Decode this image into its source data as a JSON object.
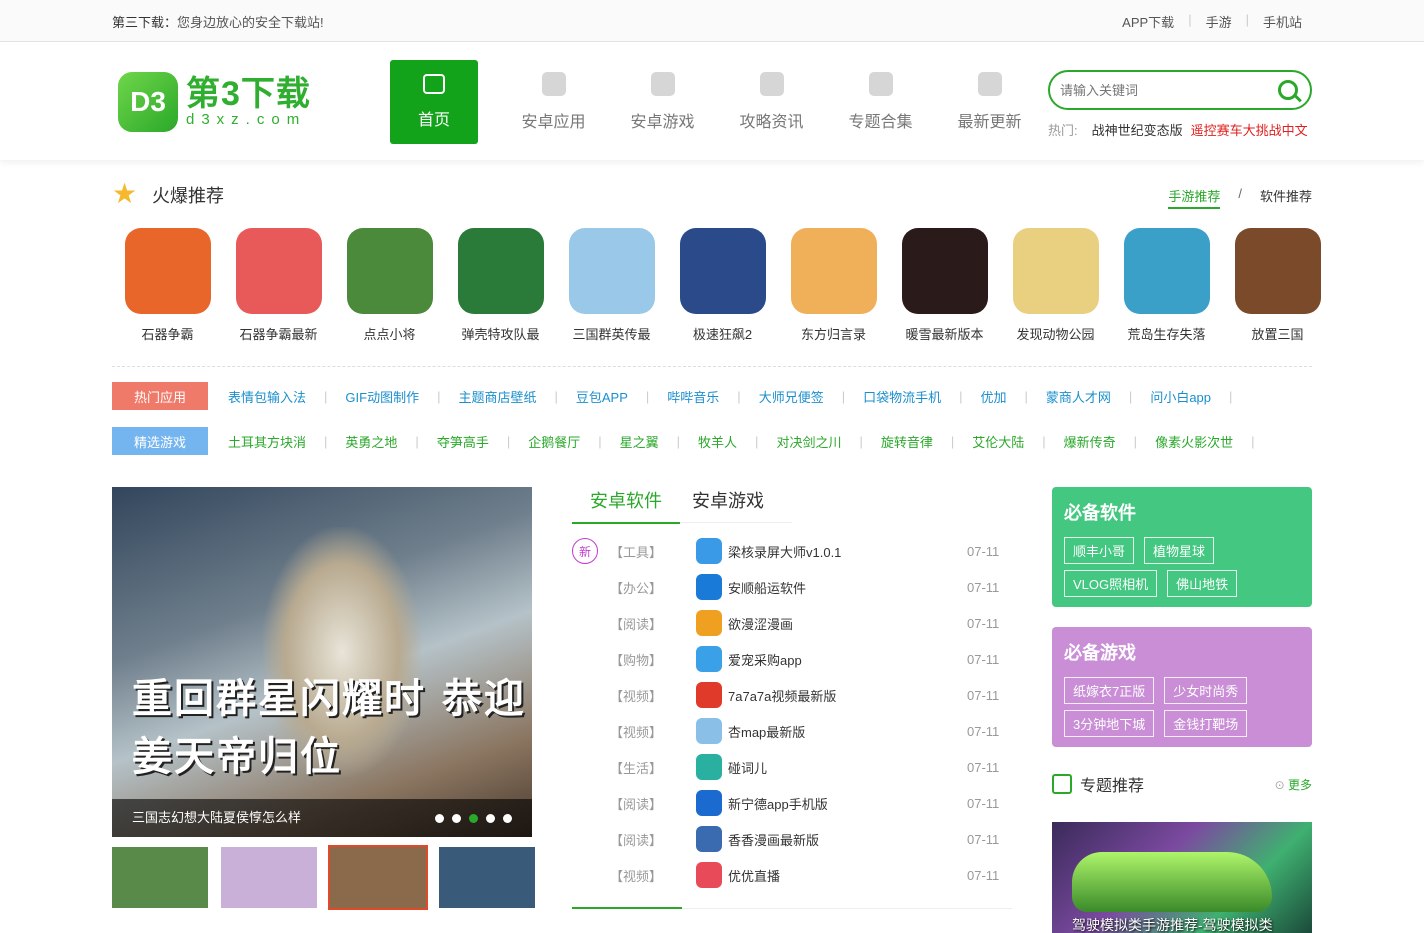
{
  "topbar": {
    "slogan_site": "第三下载：",
    "slogan_text": "您身边放心的安全下载站!",
    "links": [
      "APP下载",
      "手游",
      "手机站"
    ]
  },
  "logo": {
    "badge": "D3",
    "cn": "第3下载",
    "en": "d3xz.com"
  },
  "nav": [
    "首页",
    "安卓应用",
    "安卓游戏",
    "攻略资讯",
    "专题合集",
    "最新更新"
  ],
  "search": {
    "placeholder": "请输入关键词"
  },
  "hot": {
    "label": "热门:",
    "keywords": [
      "战神世纪变态版",
      "遥控赛车大挑战中文"
    ]
  },
  "section": {
    "title": "火爆推荐",
    "tab_active": "手游推荐",
    "tab_sep": "/",
    "tab_other": "软件推荐"
  },
  "apps": [
    {
      "name": "石器争霸",
      "color": "#e8662a"
    },
    {
      "name": "石器争霸最新",
      "color": "#e85a5a"
    },
    {
      "name": "点点小将",
      "color": "#4a8a3a"
    },
    {
      "name": "弹壳特攻队最",
      "color": "#2a7a3a"
    },
    {
      "name": "三国群英传最",
      "color": "#9ac8e8"
    },
    {
      "name": "极速狂飙2",
      "color": "#2a4a8a"
    },
    {
      "name": "东方归言录",
      "color": "#f0b05a"
    },
    {
      "name": "暖雪最新版本",
      "color": "#2a1a1a"
    },
    {
      "name": "发现动物公园",
      "color": "#e8d080"
    },
    {
      "name": "荒岛生存失落",
      "color": "#3aa0c8"
    },
    {
      "name": "放置三国",
      "color": "#7a4a2a"
    }
  ],
  "hot_apps": {
    "label": "热门应用",
    "items": [
      "表情包输入法",
      "GIF动图制作",
      "主题商店壁纸",
      "豆包APP",
      "哔哔音乐",
      "大师兄便签",
      "口袋物流手机",
      "优加",
      "蒙商人才网",
      "问小白app"
    ]
  },
  "picked_games": {
    "label": "精选游戏",
    "items": [
      "土耳其方块消",
      "英勇之地",
      "夺笋高手",
      "企鹅餐厅",
      "星之翼",
      "牧羊人",
      "对决剑之川",
      "旋转音律",
      "艾伦大陆",
      "爆新传奇",
      "像素火影次世"
    ]
  },
  "banner": {
    "headline": "重回群星闪耀时 恭迎姜天帝归位",
    "caption": "三国志幻想大陆夏侯惇怎么样",
    "thumbs": [
      "#5a8a4a",
      "#c8b0d8",
      "#8a6a4a",
      "#3a5a7a"
    ]
  },
  "mid": {
    "tab_active": "安卓软件",
    "tab_other": "安卓游戏",
    "new_badge": "新",
    "items": [
      {
        "cat": "【工具】",
        "name": "梁核录屏大师v1.0.1",
        "date": "07-11",
        "color": "#3a9ae8"
      },
      {
        "cat": "【办公】",
        "name": "安顺船运软件",
        "date": "07-11",
        "color": "#1a7ad8"
      },
      {
        "cat": "【阅读】",
        "name": "欲漫涩漫画",
        "date": "07-11",
        "color": "#f0a020"
      },
      {
        "cat": "【购物】",
        "name": "爱宠采购app",
        "date": "07-11",
        "color": "#3aa0e8"
      },
      {
        "cat": "【视频】",
        "name": "7a7a7a视频最新版",
        "date": "07-11",
        "color": "#e03a2a"
      },
      {
        "cat": "【视频】",
        "name": "杏map最新版",
        "date": "07-11",
        "color": "#8ac0e8"
      },
      {
        "cat": "【生活】",
        "name": "碰词儿",
        "date": "07-11",
        "color": "#2ab0a0"
      },
      {
        "cat": "【阅读】",
        "name": "新宁德app手机版",
        "date": "07-11",
        "color": "#1a6ad0"
      },
      {
        "cat": "【阅读】",
        "name": "香香漫画最新版",
        "date": "07-11",
        "color": "#3a6ab0"
      },
      {
        "cat": "【视频】",
        "name": "优优直播",
        "date": "07-11",
        "color": "#e84a5a"
      }
    ]
  },
  "must_soft": {
    "title": "必备软件",
    "tags": [
      "顺丰小哥",
      "植物星球",
      "VLOG照相机",
      "佛山地铁"
    ]
  },
  "must_game": {
    "title": "必备游戏",
    "tags": [
      "纸嫁衣7正版",
      "少女时尚秀",
      "3分钟地下城",
      "金钱打靶场"
    ]
  },
  "topic": {
    "title": "专题推荐",
    "more": "更多",
    "card_title": "驾驶模拟类手游推荐-驾驶模拟类"
  }
}
